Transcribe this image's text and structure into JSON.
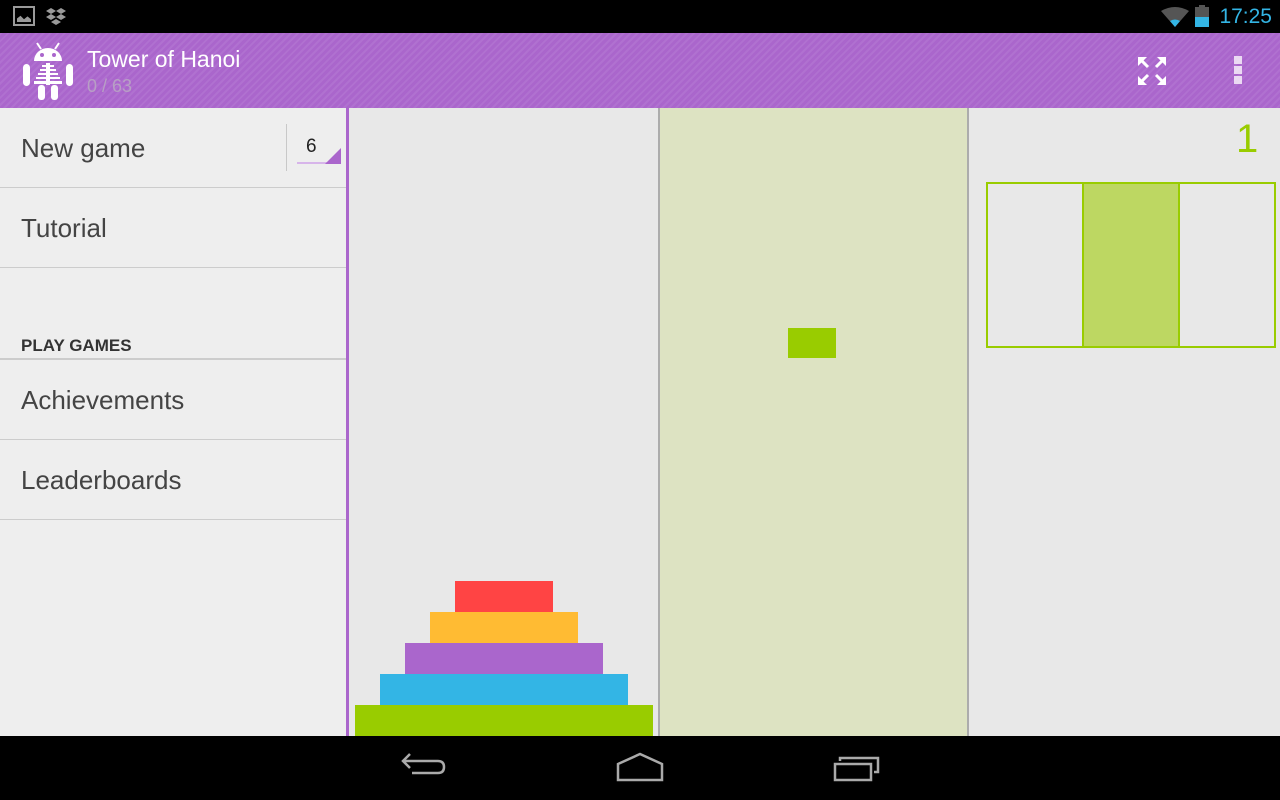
{
  "status_bar": {
    "time": "17:25",
    "icons": [
      "image-notification-icon",
      "dropbox-icon",
      "wifi-icon",
      "battery-icon"
    ],
    "time_color": "#33b5e5"
  },
  "action_bar": {
    "title": "Tower of Hanoi",
    "subtitle": "0 / 63",
    "color": "#aa66cc",
    "actions": [
      "fullscreen-icon",
      "overflow-menu-icon"
    ]
  },
  "drawer": {
    "new_game": {
      "label": "New game",
      "disk_count": "6"
    },
    "tutorial": {
      "label": "Tutorial"
    },
    "section_header": "PLAY GAMES",
    "achievements": {
      "label": "Achievements"
    },
    "leaderboards": {
      "label": "Leaderboards"
    }
  },
  "game": {
    "move_counter": "1",
    "selected_tower": 2,
    "towers": [
      {
        "name": "tower-1",
        "disks": [
          {
            "size": 6,
            "color": "#99cc00"
          },
          {
            "size": 5,
            "color": "#33b5e5"
          },
          {
            "size": 4,
            "color": "#aa66cc"
          },
          {
            "size": 3,
            "color": "#ffbb33"
          },
          {
            "size": 2,
            "color": "#ff4444"
          }
        ]
      },
      {
        "name": "tower-2",
        "disks": [],
        "lifted_disk": {
          "size": 1,
          "color": "#99cc00"
        }
      },
      {
        "name": "tower-3",
        "disks": []
      }
    ],
    "minimap": {
      "cells": 3,
      "active_index": 1
    },
    "accent_color": "#99cc00"
  },
  "nav_bar": {
    "buttons": [
      "back-icon",
      "home-icon",
      "recents-icon"
    ]
  }
}
